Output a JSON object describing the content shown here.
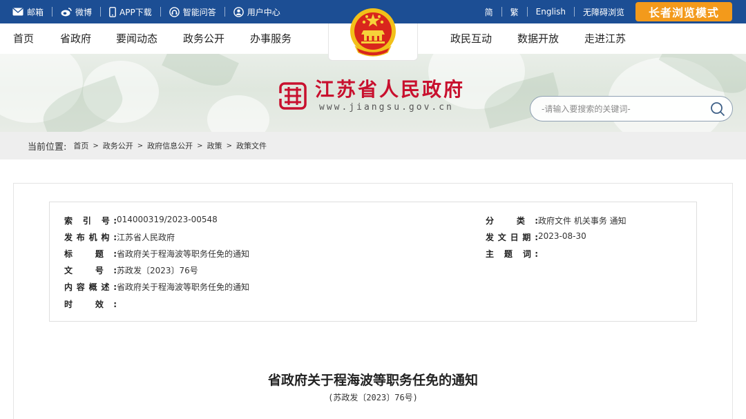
{
  "topbar": {
    "links": [
      {
        "label": "邮箱",
        "icon": "mail-icon"
      },
      {
        "label": "微博",
        "icon": "weibo-icon"
      },
      {
        "label": "APP下载",
        "icon": "phone-icon"
      },
      {
        "label": "智能问答",
        "icon": "support-icon"
      },
      {
        "label": "用户中心",
        "icon": "user-icon"
      }
    ],
    "right": [
      "简",
      "繁",
      "English",
      "无障碍浏览"
    ],
    "elder_mode": "长者浏览模式"
  },
  "nav": {
    "left": [
      "首页",
      "省政府",
      "要闻动态",
      "政务公开",
      "办事服务"
    ],
    "right": [
      "政民互动",
      "数据开放",
      "走进江苏"
    ]
  },
  "logo": {
    "title": "江苏省人民政府",
    "url": "www.jiangsu.gov.cn"
  },
  "search": {
    "placeholder": "-请输入要搜索的关键词-"
  },
  "breadcrumb": {
    "label": "当前位置:",
    "items": [
      "首页",
      "政务公开",
      "政府信息公开",
      "政策",
      "政策文件"
    ]
  },
  "meta": {
    "index_key": "索 引 号:",
    "index_val": "014000319/2023-00548",
    "publisher_key": "发布机构:",
    "publisher_val": "江苏省人民政府",
    "title_key": "标 题:",
    "title_val": "省政府关于程海波等职务任免的通知",
    "docno_key": "文 号:",
    "docno_val": "苏政发〔2023〕76号",
    "summary_key": "内容概述:",
    "summary_val": "省政府关于程海波等职务任免的通知",
    "validity_key": "时 效:",
    "validity_val": "",
    "category_key": "分 类:",
    "category_val": "政府文件 机关事务 通知",
    "date_key": "发文日期:",
    "date_val": "2023-08-30",
    "subject_key": "主 题 词:",
    "subject_val": ""
  },
  "document": {
    "title": "省政府关于程海波等职务任免的通知",
    "number": "(苏政发〔2023〕76号)"
  },
  "colors": {
    "topbar": "#1c4e94",
    "elder": "#f39a1b",
    "brand_red": "#c8102e"
  }
}
